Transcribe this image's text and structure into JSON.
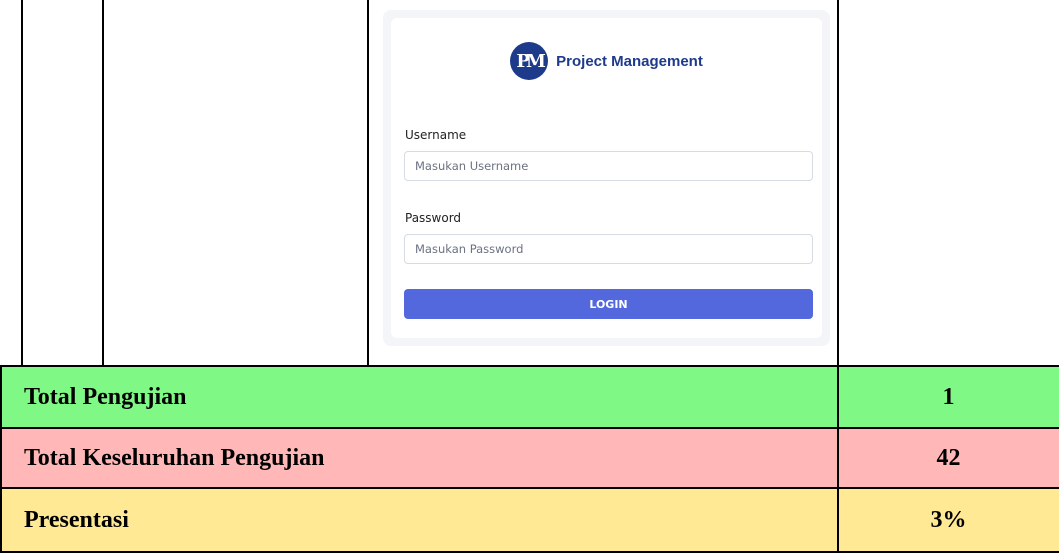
{
  "login": {
    "brand_mark": "PM",
    "brand_name": "Project Management",
    "username_label": "Username",
    "username_placeholder": "Masukan Username",
    "password_label": "Password",
    "password_placeholder": "Masukan Password",
    "login_button": "LOGIN"
  },
  "summary": {
    "rows": [
      {
        "label": "Total Pengujian",
        "value": "1",
        "color": "#80f885"
      },
      {
        "label": "Total Keseluruhan Pengujian",
        "value": "42",
        "color": "#ffb7b7"
      },
      {
        "label": "Presentasi",
        "value": "3%",
        "color": "#ffe994"
      }
    ]
  }
}
